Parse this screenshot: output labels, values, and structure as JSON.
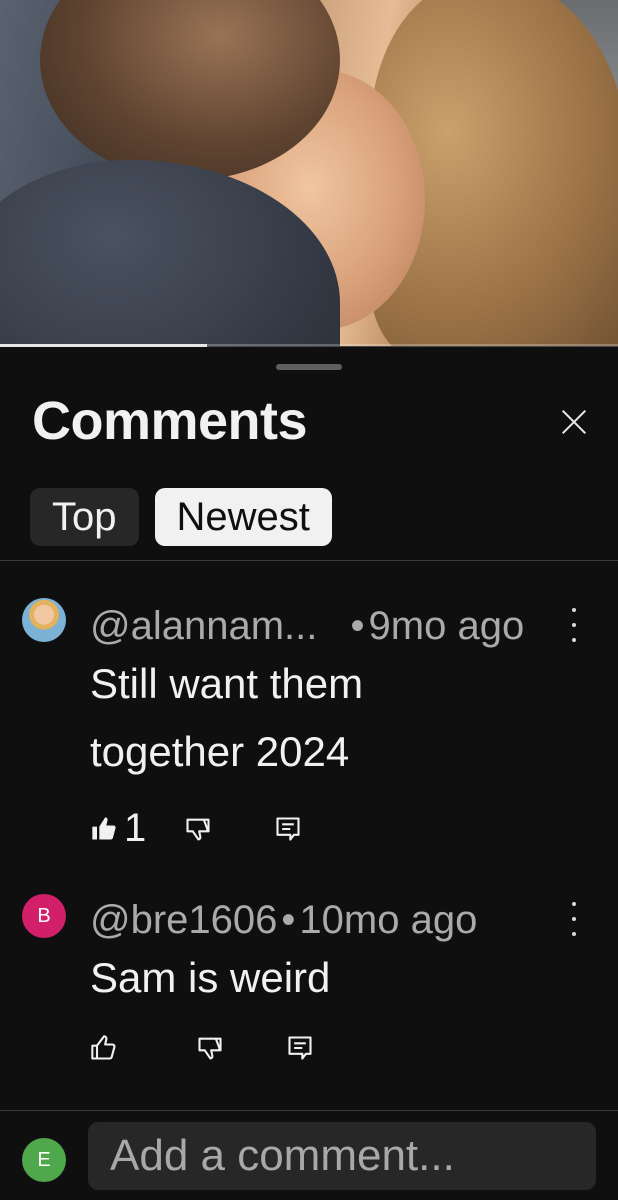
{
  "video": {
    "progress_fraction": 0.335
  },
  "sheet": {
    "title": "Comments",
    "tabs": [
      {
        "label": "Top",
        "active": false
      },
      {
        "label": "Newest",
        "active": true
      }
    ]
  },
  "comments": [
    {
      "handle": "@alannam...",
      "separator": "•",
      "time": "9mo ago",
      "text_lines": [
        "Still want them",
        "together 2024"
      ],
      "like_count": "1",
      "liked": true,
      "avatar_icon": "profile-photo"
    },
    {
      "handle": "@bre1606",
      "separator": "•",
      "time": "10mo ago",
      "text_lines": [
        "Sam is weird"
      ],
      "like_count": "",
      "liked": false,
      "avatar_letter": "B",
      "avatar_color": "#d11f6a"
    }
  ],
  "composer": {
    "avatar_letter": "E",
    "avatar_color": "#4fa84b",
    "placeholder": "Add a comment..."
  },
  "colors": {
    "background": "#0f0f0f",
    "chip_active_bg": "#f1f1f1",
    "chip_bg": "#272727",
    "meta_text": "#aaaaaa"
  }
}
